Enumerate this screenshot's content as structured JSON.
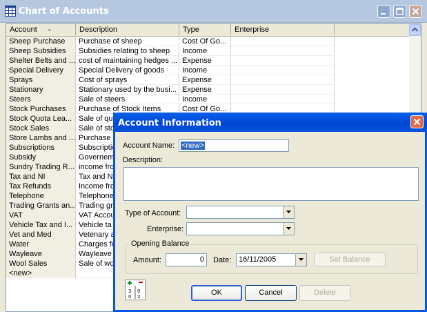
{
  "main_window": {
    "title": "Chart of Accounts",
    "columns": [
      "Account",
      "Description",
      "Type",
      "Enterprise"
    ],
    "rows": [
      {
        "account": "Sheep Purchase",
        "description": "Purchase of sheep",
        "type": "Cost Of Go..."
      },
      {
        "account": "Sheep Subsidies",
        "description": "Subsidies relating to sheep",
        "type": "Income"
      },
      {
        "account": "Shelter Belts and ...",
        "description": "cost of maintaining hedges ...",
        "type": "Expense"
      },
      {
        "account": "Special Delivery",
        "description": "Special Delivery of goods",
        "type": "Income"
      },
      {
        "account": "Sprays",
        "description": "Cost of sprays",
        "type": "Expense"
      },
      {
        "account": "Stationary",
        "description": "Stationary used by the busi...",
        "type": "Expense"
      },
      {
        "account": "Steers",
        "description": "Sale of steers",
        "type": "Income"
      },
      {
        "account": "Stock Purchases",
        "description": "Purchase of Stock Items",
        "type": "Cost Of Go..."
      },
      {
        "account": "Stock Quota Lea...",
        "description": "Sale of qu",
        "type": ""
      },
      {
        "account": "Stock Sales",
        "description": "Sale of sto",
        "type": ""
      },
      {
        "account": "Store Lambs and ...",
        "description": "Purchase",
        "type": ""
      },
      {
        "account": "Subscriptions",
        "description": "Subscriptio",
        "type": ""
      },
      {
        "account": "Subsidy",
        "description": "Governem",
        "type": ""
      },
      {
        "account": "Sundry Trading R...",
        "description": "income fro",
        "type": ""
      },
      {
        "account": "Tax and NI",
        "description": "Tax and N",
        "type": ""
      },
      {
        "account": "Tax Refunds",
        "description": "Income fro",
        "type": ""
      },
      {
        "account": "Telephone",
        "description": "Telephone",
        "type": ""
      },
      {
        "account": "Trading Grants an...",
        "description": "Trading gr",
        "type": ""
      },
      {
        "account": "VAT",
        "description": "VAT Accou",
        "type": ""
      },
      {
        "account": "Vehicle Tax and I...",
        "description": "Vehicle ta",
        "type": ""
      },
      {
        "account": "Vet and Med",
        "description": "Vetenary a",
        "type": ""
      },
      {
        "account": "Water",
        "description": "Charges fo",
        "type": ""
      },
      {
        "account": "Wayleave",
        "description": "Wayleave",
        "type": ""
      },
      {
        "account": "Wool Sales",
        "description": "Sale of wo",
        "type": ""
      },
      {
        "account": "<new>",
        "description": "",
        "type": ""
      }
    ]
  },
  "dialog": {
    "title": "Account Information",
    "account_name_label": "Account Name:",
    "account_name_value": "<new>",
    "description_label": "Description:",
    "type_label": "Type of Account:",
    "enterprise_label": "Enterprise:",
    "opening_balance_label": "Opening Balance",
    "amount_label": "Amount:",
    "amount_value": "0",
    "date_label": "Date:",
    "date_value": "16/11/2005",
    "set_balance_label": "Set Balance",
    "ok_label": "OK",
    "cancel_label": "Cancel",
    "delete_label": "Delete"
  },
  "colors": {
    "title_active": "#0055e5",
    "selection": "#316ac5"
  }
}
